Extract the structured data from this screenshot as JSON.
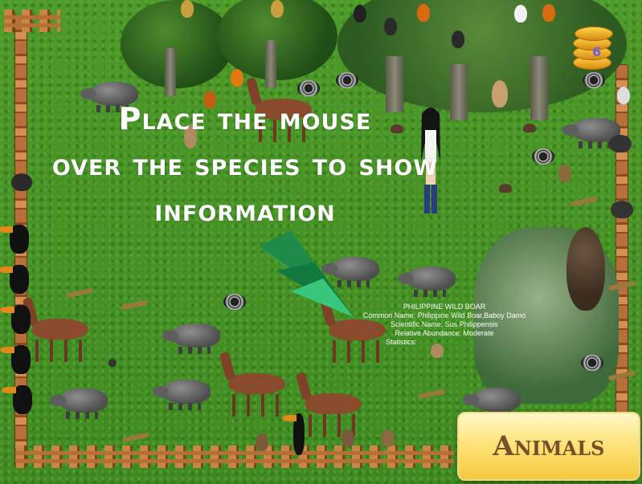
{
  "game": {
    "instruction": "Place the mouse over the species to show information",
    "instruction_lines": [
      "Place the mouse",
      "over the species to show",
      "information"
    ],
    "coin_counter": "6",
    "animals_button_label": "Animals",
    "tooltip": {
      "title": "PHILIPPINE WILD BOAR",
      "common_name": "Common Name: Philippine Wild Boar,Baboy Damo",
      "scientific_name": "Scientific Name: Sus Philippensis",
      "relative_abundance": "Relative Abundance: Moderate",
      "statistics": "Statistics:"
    }
  },
  "colors": {
    "grass": "#4e9a2a",
    "fence": "#b8703a",
    "button_face": "#ffe47c",
    "button_text": "#7a4e2a",
    "cursor_arrow": "#1aa05a",
    "text": "#ffffff"
  },
  "icons": {
    "coin_stack": "coin-stack-icon",
    "cursor": "paper-arrow-cursor-icon"
  }
}
